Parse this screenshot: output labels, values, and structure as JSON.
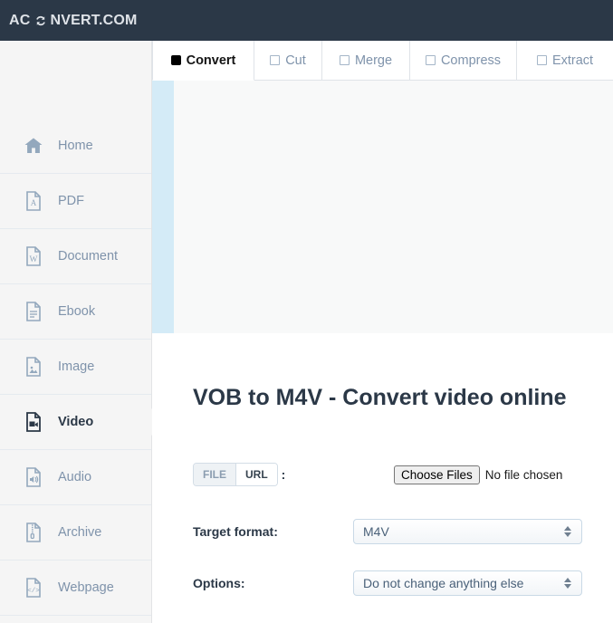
{
  "header": {
    "logo_prefix": "AC",
    "logo_icon": "refresh-circular-arrows-icon",
    "logo_suffix": "NVERT.COM",
    "bg_color": "#2b3847"
  },
  "sidebar": {
    "items": [
      {
        "label": "Home",
        "icon": "home-icon",
        "active": false
      },
      {
        "label": "PDF",
        "icon": "pdf-file-icon",
        "active": false
      },
      {
        "label": "Document",
        "icon": "word-document-file-icon",
        "active": false
      },
      {
        "label": "Ebook",
        "icon": "ebook-file-icon",
        "active": false
      },
      {
        "label": "Image",
        "icon": "image-file-icon",
        "active": false
      },
      {
        "label": "Video",
        "icon": "video-file-icon",
        "active": true
      },
      {
        "label": "Audio",
        "icon": "audio-file-icon",
        "active": false
      },
      {
        "label": "Archive",
        "icon": "archive-zip-file-icon",
        "active": false
      },
      {
        "label": "Webpage",
        "icon": "webpage-code-file-icon",
        "active": false
      }
    ]
  },
  "tabs": [
    {
      "label": "Convert",
      "icon": "checkbox-checked-icon",
      "active": true
    },
    {
      "label": "Cut",
      "icon": "checkbox-unchecked-icon",
      "active": false
    },
    {
      "label": "Merge",
      "icon": "checkbox-unchecked-icon",
      "active": false
    },
    {
      "label": "Compress",
      "icon": "checkbox-unchecked-icon",
      "active": false
    },
    {
      "label": "Extract",
      "icon": "checkbox-unchecked-icon",
      "active": false
    }
  ],
  "main": {
    "title": "VOB to M4V - Convert video online",
    "source_toggle": {
      "file_label": "FILE",
      "url_label": "URL",
      "selected": "FILE",
      "colon": ":"
    },
    "file_input": {
      "button_label": "Choose Files",
      "status_text": "No file chosen"
    },
    "target_format": {
      "label": "Target format:",
      "value": "M4V"
    },
    "options": {
      "label": "Options:",
      "value": "Do not change anything else"
    }
  },
  "colors": {
    "accent_blue_strip": "#d4ebf7",
    "sidebar_bg": "#f5f5f5",
    "panel_bg": "#f8f9f9",
    "muted_text": "#7f93ab",
    "dark_text": "#2b3847"
  }
}
